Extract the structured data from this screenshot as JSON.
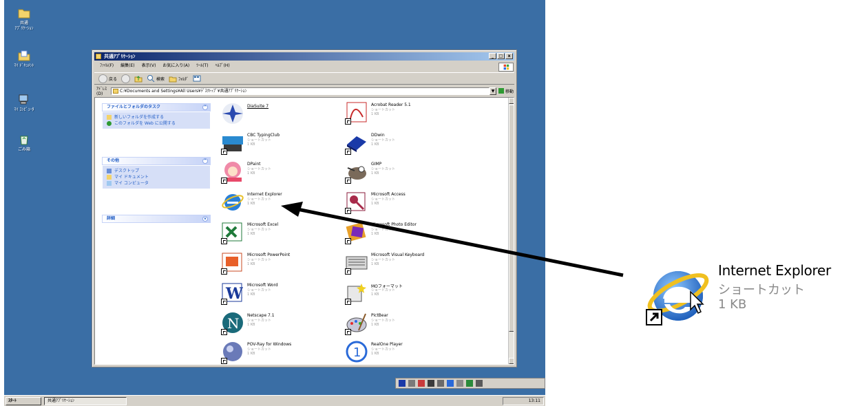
{
  "desktop": {
    "icons": [
      {
        "label": "共通\nｱﾌﾟﾘｹｰｼｮﾝ",
        "icon": "folder-icon"
      },
      {
        "label": "ﾏｲ ﾄﾞｷｭﾒﾝﾄ",
        "icon": "my-documents-icon"
      },
      {
        "label": "ﾏｲ ｺﾝﾋﾟｭｰﾀ",
        "icon": "my-computer-icon"
      },
      {
        "label": "ごみ箱",
        "icon": "recycle-bin-icon"
      }
    ]
  },
  "window": {
    "title": "共通ｱﾌﾟﾘｹｰｼｮﾝ",
    "controls": {
      "minimize": "_",
      "maximize": "□",
      "close": "x"
    },
    "menu": [
      "ﾌｧｲﾙ(F)",
      "編集(E)",
      "表示(V)",
      "お気に入り(A)",
      "ﾂｰﾙ(T)",
      "ﾍﾙﾌﾟ(H)"
    ],
    "toolbar": {
      "back": "戻る",
      "search": "検索",
      "folders": "ﾌｫﾙﾀﾞ"
    },
    "address": {
      "label": "ｱﾄﾞﾚｽ(D)",
      "value": "C:¥Documents and Settings¥All Users¥ﾃﾞｽｸﾄｯﾌﾟ¥共通ｱﾌﾟﾘｹｰｼｮﾝ",
      "go_label": "移動"
    }
  },
  "taskpane": {
    "panels": [
      {
        "title": "ファイルとフォルダのタスク",
        "items": [
          "新しいフォルダを作成する",
          "このフォルダを Web に公開する"
        ]
      },
      {
        "title": "その他",
        "items": [
          "デスクトップ",
          "マイ ドキュメント",
          "マイ コンピュータ"
        ]
      },
      {
        "title": "詳細",
        "items": []
      }
    ]
  },
  "files": [
    {
      "name": "DiaSuite 7",
      "sub": "",
      "icon": "diasuite-icon"
    },
    {
      "name": "Acrobat Reader 5.1",
      "sub": "ショートカット\n1 KB",
      "icon": "acrobat-reader-icon"
    },
    {
      "name": "CBC TypingClub",
      "sub": "ショートカット\n1 KB",
      "icon": "typing-club-icon"
    },
    {
      "name": "DDwin",
      "sub": "ショートカット\n1 KB",
      "icon": "ddwin-icon"
    },
    {
      "name": "DPaint",
      "sub": "ショートカット\n1 KB",
      "icon": "dpaint-icon"
    },
    {
      "name": "GIMP",
      "sub": "ショートカット\n1 KB",
      "icon": "gimp-icon"
    },
    {
      "name": "Internet Explorer",
      "sub": "ショートカット\n1 KB",
      "icon": "internet-explorer-icon"
    },
    {
      "name": "Microsoft Access",
      "sub": "ショートカット\n1 KB",
      "icon": "ms-access-icon"
    },
    {
      "name": "Microsoft Excel",
      "sub": "ショートカット\n1 KB",
      "icon": "ms-excel-icon"
    },
    {
      "name": "Microsoft Photo Editor",
      "sub": "ショートカット\n1 KB",
      "icon": "ms-photo-editor-icon"
    },
    {
      "name": "Microsoft PowerPoint",
      "sub": "ショートカット\n1 KB",
      "icon": "ms-powerpoint-icon"
    },
    {
      "name": "Microsoft Visual Keyboard",
      "sub": "ショートカット\n1 KB",
      "icon": "visual-keyboard-icon"
    },
    {
      "name": "Microsoft Word",
      "sub": "ショートカット\n1 KB",
      "icon": "ms-word-icon"
    },
    {
      "name": "MOフォーマット",
      "sub": "ショートカット\n1 KB",
      "icon": "mo-format-icon"
    },
    {
      "name": "Netscape 7.1",
      "sub": "ショートカット\n1 KB",
      "icon": "netscape-icon"
    },
    {
      "name": "PictBear",
      "sub": "ショートカット\n1 KB",
      "icon": "pictbear-icon"
    },
    {
      "name": "POV-Ray for Windows",
      "sub": "ショートカット\n1 KB",
      "icon": "povray-icon"
    },
    {
      "name": "RealOne Player",
      "sub": "ショートカット\n1 KB",
      "icon": "realone-icon"
    }
  ],
  "taskbar": {
    "start": "ｽﾀｰﾄ",
    "task": "共通ｱﾌﾟﾘｹｰｼｮﾝ",
    "clock": "13:11"
  },
  "callout": {
    "name": "Internet Explorer",
    "type": "ショートカット",
    "size": "1 KB"
  },
  "colors": {
    "desktop": "#3a6ea5",
    "titlebar_start": "#0a246a",
    "taskpane_link": "#215dc6"
  }
}
